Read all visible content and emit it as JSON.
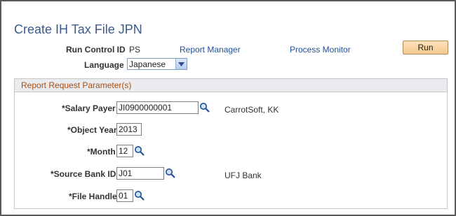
{
  "page": {
    "title": "Create IH Tax File JPN"
  },
  "header": {
    "run_control_label": "Run Control ID",
    "run_control_value": "PS",
    "report_manager": "Report Manager",
    "process_monitor": "Process Monitor",
    "run_button": "Run",
    "language_label": "Language",
    "language_value": "Japanese"
  },
  "params": {
    "group_title": "Report Request Parameter(s)",
    "salary_payer_label": "*Salary Payer",
    "salary_payer_value": "JI0900000001",
    "salary_payer_desc": "CarrotSoft, KK",
    "object_year_label": "*Object Year",
    "object_year_value": "2013",
    "month_label": "*Month",
    "month_value": "12",
    "source_bank_label": "*Source Bank ID",
    "source_bank_value": "J01",
    "source_bank_desc": "UFJ Bank",
    "file_handle_label": "*File Handle",
    "file_handle_value": "01"
  },
  "colors": {
    "title": "#3d5a8a",
    "link": "#1f4f9a",
    "group_title": "#a84f16",
    "run_button": "#f3c98c"
  },
  "icons": {
    "lookup": "magnifier-icon",
    "dropdown": "chevron-down-icon"
  }
}
